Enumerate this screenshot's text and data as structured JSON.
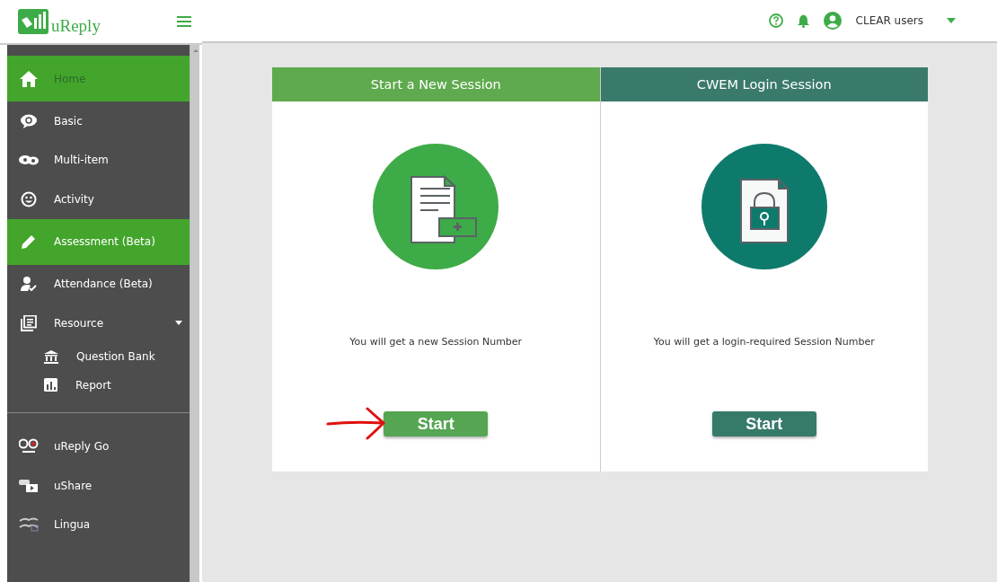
{
  "logo": {
    "text": "uReply"
  },
  "user": {
    "name": "CLEAR users"
  },
  "sidebar": {
    "items": [
      {
        "label": "Home",
        "kind": "home",
        "selected": true,
        "dimmed": true
      },
      {
        "label": "Basic",
        "kind": "basic",
        "selected": false,
        "dimmed": false
      },
      {
        "label": "Multi-item",
        "kind": "multi",
        "selected": false,
        "dimmed": false
      },
      {
        "label": "Activity",
        "kind": "activity",
        "selected": false,
        "dimmed": false
      },
      {
        "label": "Assessment (Beta)",
        "kind": "pencil",
        "selected": true,
        "dimmed": false
      },
      {
        "label": "Attendance (Beta)",
        "kind": "attendance",
        "selected": false,
        "dimmed": false
      },
      {
        "label": "Resource",
        "kind": "resource",
        "selected": false,
        "dimmed": false,
        "expanded": true,
        "children": [
          {
            "label": "Question Bank",
            "kind": "bank"
          },
          {
            "label": "Report",
            "kind": "report"
          }
        ]
      }
    ],
    "apps": [
      {
        "label": "uReply Go",
        "kind": "go"
      },
      {
        "label": "uShare",
        "kind": "share"
      },
      {
        "label": "Lingua",
        "kind": "lingua"
      }
    ]
  },
  "cards": [
    {
      "title": "Start a New Session",
      "kind": "new",
      "description": "You will get a new Session Number",
      "button": "Start",
      "annotated": true
    },
    {
      "title": "CWEM Login Session",
      "kind": "login",
      "description": "You will get a login-required Session Number",
      "button": "Start",
      "annotated": false
    }
  ]
}
